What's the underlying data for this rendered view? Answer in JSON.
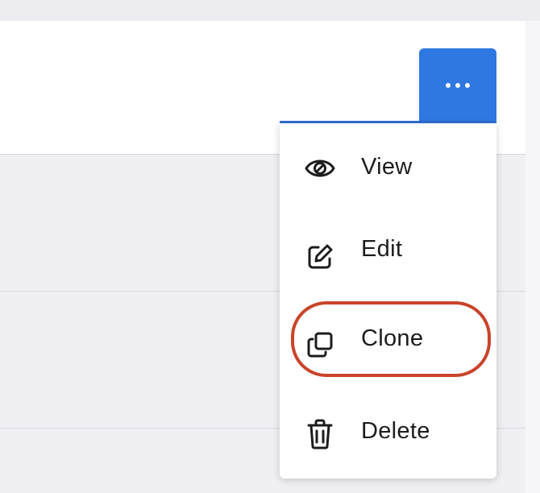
{
  "colors": {
    "accent_button": "#2f78e2",
    "highlight_ring": "#c9442a",
    "menu_text": "#1c1c1e"
  },
  "more_button": {
    "icon": "more-horizontal-icon"
  },
  "menu": {
    "items": [
      {
        "label": "View",
        "icon": "eye-icon"
      },
      {
        "label": "Edit",
        "icon": "edit-pencil-icon"
      },
      {
        "label": "Clone",
        "icon": "clone-copy-icon"
      },
      {
        "label": "Delete",
        "icon": "trash-icon"
      }
    ],
    "highlighted_item": "Clone"
  }
}
